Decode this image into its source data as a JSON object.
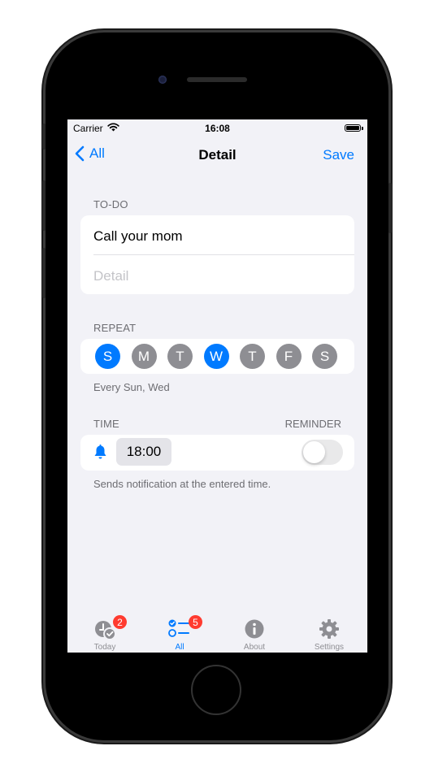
{
  "status": {
    "carrier": "Carrier",
    "time": "16:08"
  },
  "nav": {
    "back_label": "All",
    "title": "Detail",
    "save_label": "Save"
  },
  "todo": {
    "header": "TO-DO",
    "title": "Call your mom",
    "detail_placeholder": "Detail"
  },
  "repeat": {
    "header": "REPEAT",
    "days": [
      {
        "label": "S",
        "selected": true
      },
      {
        "label": "M",
        "selected": false
      },
      {
        "label": "T",
        "selected": false
      },
      {
        "label": "W",
        "selected": true
      },
      {
        "label": "T",
        "selected": false
      },
      {
        "label": "F",
        "selected": false
      },
      {
        "label": "S",
        "selected": false
      }
    ],
    "summary": "Every Sun, Wed"
  },
  "time": {
    "header": "TIME",
    "reminder_header": "REMINDER",
    "value": "18:00",
    "reminder_on": false,
    "footer": "Sends notification at the entered time."
  },
  "tabs": [
    {
      "label": "Today",
      "badge": "2",
      "icon": "clock-check-icon",
      "active": false
    },
    {
      "label": "All",
      "badge": "5",
      "icon": "checklist-icon",
      "active": true
    },
    {
      "label": "About",
      "badge": null,
      "icon": "info-icon",
      "active": false
    },
    {
      "label": "Settings",
      "badge": null,
      "icon": "gear-icon",
      "active": false
    }
  ],
  "colors": {
    "accent": "#007aff",
    "badge": "#ff3b30",
    "day_off": "#8e8e93",
    "background": "#f2f2f7"
  }
}
